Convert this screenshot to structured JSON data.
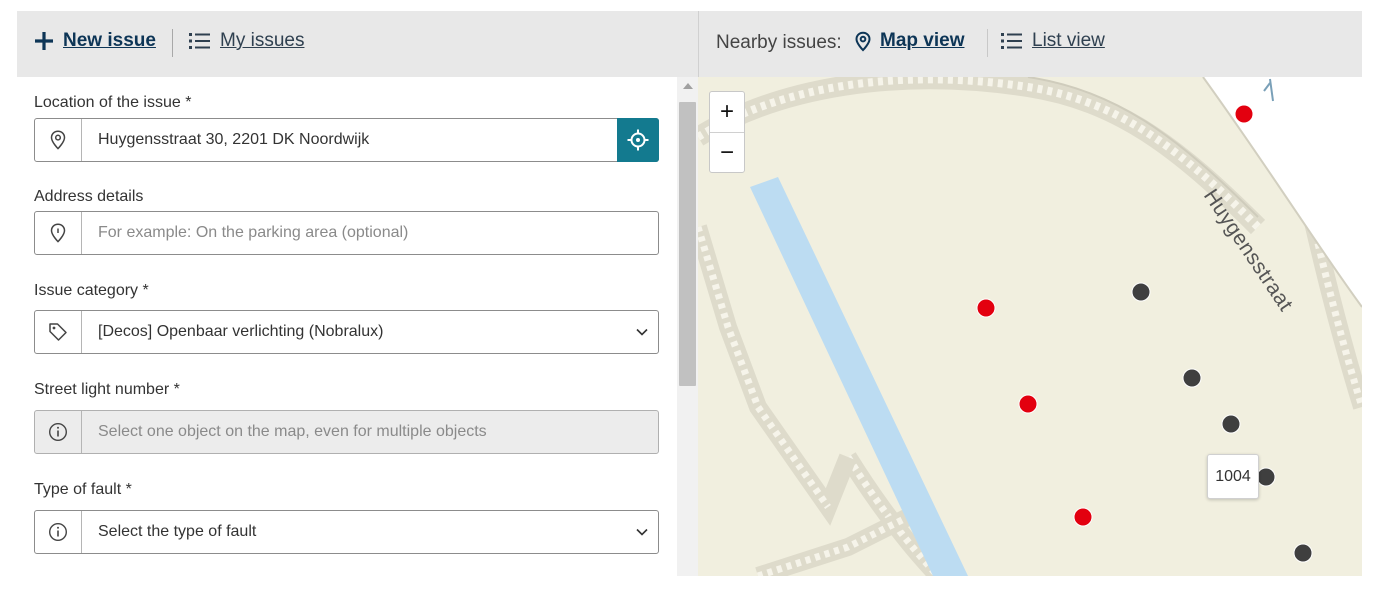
{
  "header": {
    "new_issue_label": "New issue",
    "my_issues_label": "My issues",
    "nearby_label": "Nearby issues:",
    "map_view_label": "Map view",
    "list_view_label": "List view"
  },
  "form": {
    "location": {
      "label": "Location of the issue *",
      "value": "Huygensstraat 30, 2201 DK Noordwijk",
      "icon": "location-pin-icon"
    },
    "address_details": {
      "label": "Address details",
      "placeholder": "For example: On the parking area (optional)",
      "icon": "location-pin-icon"
    },
    "category": {
      "label": "Issue category *",
      "value": "[Decos] Openbaar verlichting (Nobralux)",
      "icon": "tag-icon"
    },
    "street_light": {
      "label": "Street light number *",
      "placeholder": "Select one object on the map, even for multiple objects",
      "icon": "info-icon"
    },
    "fault_type": {
      "label": "Type of fault *",
      "value": "Select the type of fault",
      "icon": "info-icon"
    }
  },
  "map": {
    "street_name": "Huygensstraat",
    "zoom_in": "+",
    "zoom_out": "−",
    "tooltip": "1004",
    "colors": {
      "issue": "#e3000f",
      "object": "#3f3f3f",
      "water": "#bcdcf2",
      "land": "#f1efdf"
    }
  }
}
